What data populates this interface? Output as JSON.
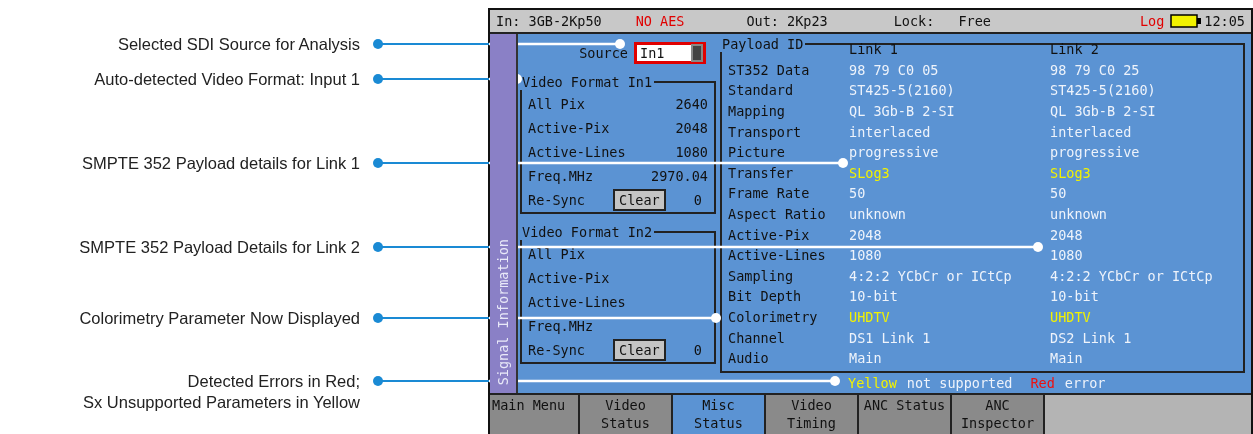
{
  "annotations": [
    {
      "lines": [
        "Selected SDI Source for Analysis"
      ]
    },
    {
      "lines": [
        "Auto-detected Video Format: Input 1"
      ]
    },
    {
      "lines": [
        "SMPTE 352 Payload details for Link 1"
      ]
    },
    {
      "lines": [
        "SMPTE 352 Payload Details for Link 2"
      ]
    },
    {
      "lines": [
        "Colorimetry Parameter Now Displayed"
      ]
    },
    {
      "lines": [
        "Detected Errors in Red;",
        "Sx Unsupported Parameters in Yellow"
      ]
    }
  ],
  "status_bar": {
    "input": "In: 3GB-2Kp50",
    "warning": "NO AES",
    "output": "Out: 2Kp23",
    "lock_label": "Lock:",
    "lock_value": "Free",
    "log": "Log",
    "time": "12:05"
  },
  "side_tab": {
    "label": "Signal Information"
  },
  "source": {
    "label": "Source",
    "value": "In1"
  },
  "video_formats": [
    {
      "title": "Video Format In1",
      "rows": [
        {
          "label": "All Pix",
          "value": "2640"
        },
        {
          "label": "Active-Pix",
          "value": "2048"
        },
        {
          "label": "Active-Lines",
          "value": "1080"
        },
        {
          "label": "Freq.MHz",
          "value": "2970.04"
        }
      ],
      "resync_label": "Re-Sync",
      "clear_button": "Clear",
      "resync_count": "0"
    },
    {
      "title": "Video Format In2",
      "rows": [
        {
          "label": "All Pix"
        },
        {
          "label": "Active-Pix"
        },
        {
          "label": "Active-Lines"
        },
        {
          "label": "Freq.MHz"
        }
      ],
      "resync_label": "Re-Sync",
      "clear_button": "Clear",
      "resync_count": "0"
    }
  ],
  "payload": {
    "title": "Payload ID",
    "columns": [
      "Link 1",
      "Link 2"
    ],
    "rows": [
      {
        "label": "ST352 Data",
        "values": [
          {
            "text": "98 79 C0 05",
            "unsupported": false
          },
          {
            "text": "98 79 C0 25",
            "unsupported": false
          }
        ]
      },
      {
        "label": "Standard",
        "values": [
          {
            "text": "ST425-5(2160)",
            "unsupported": false
          },
          {
            "text": "ST425-5(2160)",
            "unsupported": false
          }
        ]
      },
      {
        "label": "Mapping",
        "values": [
          {
            "text": "QL 3Gb-B 2-SI",
            "unsupported": false
          },
          {
            "text": "QL 3Gb-B 2-SI",
            "unsupported": false
          }
        ]
      },
      {
        "label": "Transport",
        "values": [
          {
            "text": "interlaced",
            "unsupported": false
          },
          {
            "text": "interlaced",
            "unsupported": false
          }
        ]
      },
      {
        "label": "Picture",
        "values": [
          {
            "text": "progressive",
            "unsupported": false
          },
          {
            "text": "progressive",
            "unsupported": false
          }
        ]
      },
      {
        "label": "Transfer",
        "values": [
          {
            "text": "SLog3",
            "unsupported": true
          },
          {
            "text": "SLog3",
            "unsupported": true
          }
        ]
      },
      {
        "label": "Frame Rate",
        "values": [
          {
            "text": "50",
            "unsupported": false
          },
          {
            "text": "50",
            "unsupported": false
          }
        ]
      },
      {
        "label": "Aspect Ratio",
        "values": [
          {
            "text": "unknown",
            "unsupported": false
          },
          {
            "text": "unknown",
            "unsupported": false
          }
        ]
      },
      {
        "label": "Active-Pix",
        "values": [
          {
            "text": "2048",
            "unsupported": false
          },
          {
            "text": "2048",
            "unsupported": false
          }
        ]
      },
      {
        "label": "Active-Lines",
        "values": [
          {
            "text": "1080",
            "unsupported": false
          },
          {
            "text": "1080",
            "unsupported": false
          }
        ]
      },
      {
        "label": "Sampling",
        "values": [
          {
            "text": "4:2:2 YCbCr or ICtCp",
            "unsupported": false
          },
          {
            "text": "4:2:2 YCbCr or ICtCp",
            "unsupported": false
          }
        ]
      },
      {
        "label": "Bit Depth",
        "values": [
          {
            "text": "10-bit",
            "unsupported": false
          },
          {
            "text": "10-bit",
            "unsupported": false
          }
        ]
      },
      {
        "label": "Colorimetry",
        "values": [
          {
            "text": "UHDTV",
            "unsupported": true
          },
          {
            "text": "UHDTV",
            "unsupported": true
          }
        ]
      },
      {
        "label": "Channel",
        "values": [
          {
            "text": "DS1 Link 1",
            "unsupported": false
          },
          {
            "text": "DS2 Link 1",
            "unsupported": false
          }
        ]
      },
      {
        "label": "Audio",
        "values": [
          {
            "text": "Main",
            "unsupported": false
          },
          {
            "text": "Main",
            "unsupported": false
          }
        ]
      }
    ]
  },
  "legend": [
    {
      "text": "Yellow",
      "kind": "unsupported"
    },
    {
      "text": "not supported",
      "kind": "plain"
    },
    {
      "text": "Red",
      "kind": "error"
    },
    {
      "text": "error",
      "kind": "plain"
    }
  ],
  "tabs": [
    {
      "label": "Main Menu",
      "selected": false
    },
    {
      "label": "Video Status",
      "selected": false
    },
    {
      "label": "Misc Status",
      "selected": true
    },
    {
      "label": "Video Timing",
      "selected": false
    },
    {
      "label": "ANC Status",
      "selected": false
    },
    {
      "label": "ANC Inspector",
      "selected": false
    }
  ]
}
